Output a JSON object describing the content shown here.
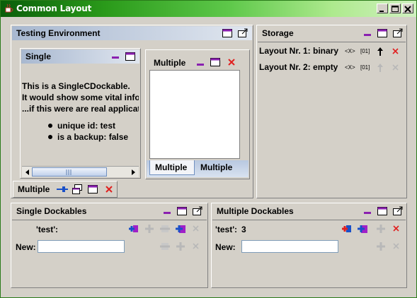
{
  "window": {
    "title": "Common Layout"
  },
  "testing": {
    "title": "Testing Environment",
    "single": {
      "title": "Single",
      "lines": [
        "This is a SingleCDockable.",
        "It would show some vital infor",
        "...if this were are real applicat"
      ],
      "bullets": [
        "unique id: test",
        "is a backup: false"
      ]
    },
    "multiple_panel": {
      "title": "Multiple",
      "tabs": [
        "Multiple",
        "Multiple"
      ]
    },
    "minimized": {
      "title": "Multiple"
    }
  },
  "storage": {
    "title": "Storage",
    "rows": [
      {
        "label": "Layout Nr. 1: binary",
        "x": "<X>",
        "o1": "[01]"
      },
      {
        "label": "Layout Nr. 2: empty",
        "x": "<X>",
        "o1": "[01]"
      }
    ]
  },
  "single_dockables": {
    "title": "Single Dockables",
    "item": "'test':",
    "new_label": "New:",
    "new_value": ""
  },
  "multiple_dockables": {
    "title": "Multiple Dockables",
    "item": "'test':",
    "count": "3",
    "new_label": "New:",
    "new_value": ""
  },
  "colors": {
    "title_start": "#0a5e0a",
    "title_end": "#d0f0c0",
    "panel_header": "#a8b8d0",
    "close_red": "#e02020",
    "icon_blue": "#1a50c8",
    "icon_magenta": "#a020c8"
  }
}
